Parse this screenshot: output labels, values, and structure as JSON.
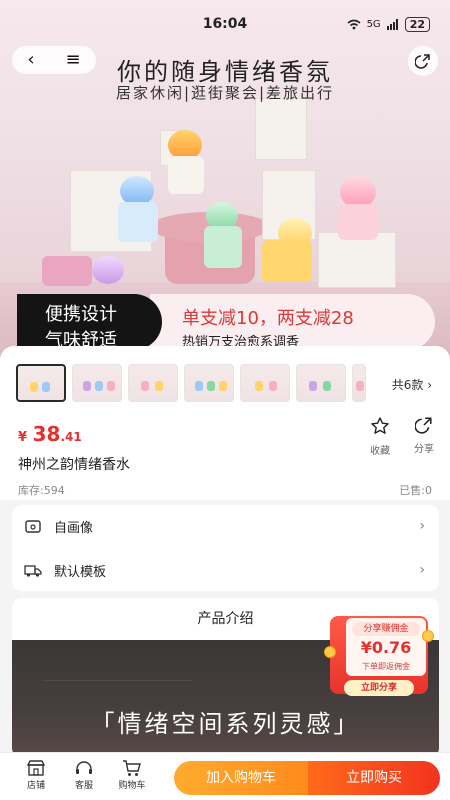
{
  "status": {
    "time": "16:04",
    "network": "5G",
    "battery": "22"
  },
  "hero": {
    "title": "你的随身情绪香氛",
    "subtitle": "居家休闲|逛街聚会|差旅出行",
    "promo_left_1": "便携设计",
    "promo_left_2": "气味舒适",
    "promo_right_1": "单支减10，两支减28",
    "promo_right_2": "热销万支治愈系调香"
  },
  "product": {
    "variant_count": "共6款",
    "currency": "¥",
    "price_int": "38",
    "price_dec": ".41",
    "favorite_label": "收藏",
    "share_label": "分享",
    "name": "神州之韵情绪香水",
    "stock": "库存:594",
    "sold": "已售:0"
  },
  "options": [
    {
      "label": "自画像"
    },
    {
      "label": "默认模板"
    }
  ],
  "intro": {
    "heading": "产品介绍",
    "banner_text": "「情绪空间系列灵感」"
  },
  "packet": {
    "title": "分享赚佣金",
    "amount": "¥0.76",
    "note": "下单即返佣金",
    "button": "立即分享"
  },
  "bottom": {
    "store": "店铺",
    "service": "客服",
    "cart": "购物车",
    "add_to_cart": "加入购物车",
    "buy_now": "立即购买"
  },
  "colors": {
    "price_red": "#e3312d",
    "cart_orange": "#ff9a24",
    "buy_red": "#f2331f"
  }
}
